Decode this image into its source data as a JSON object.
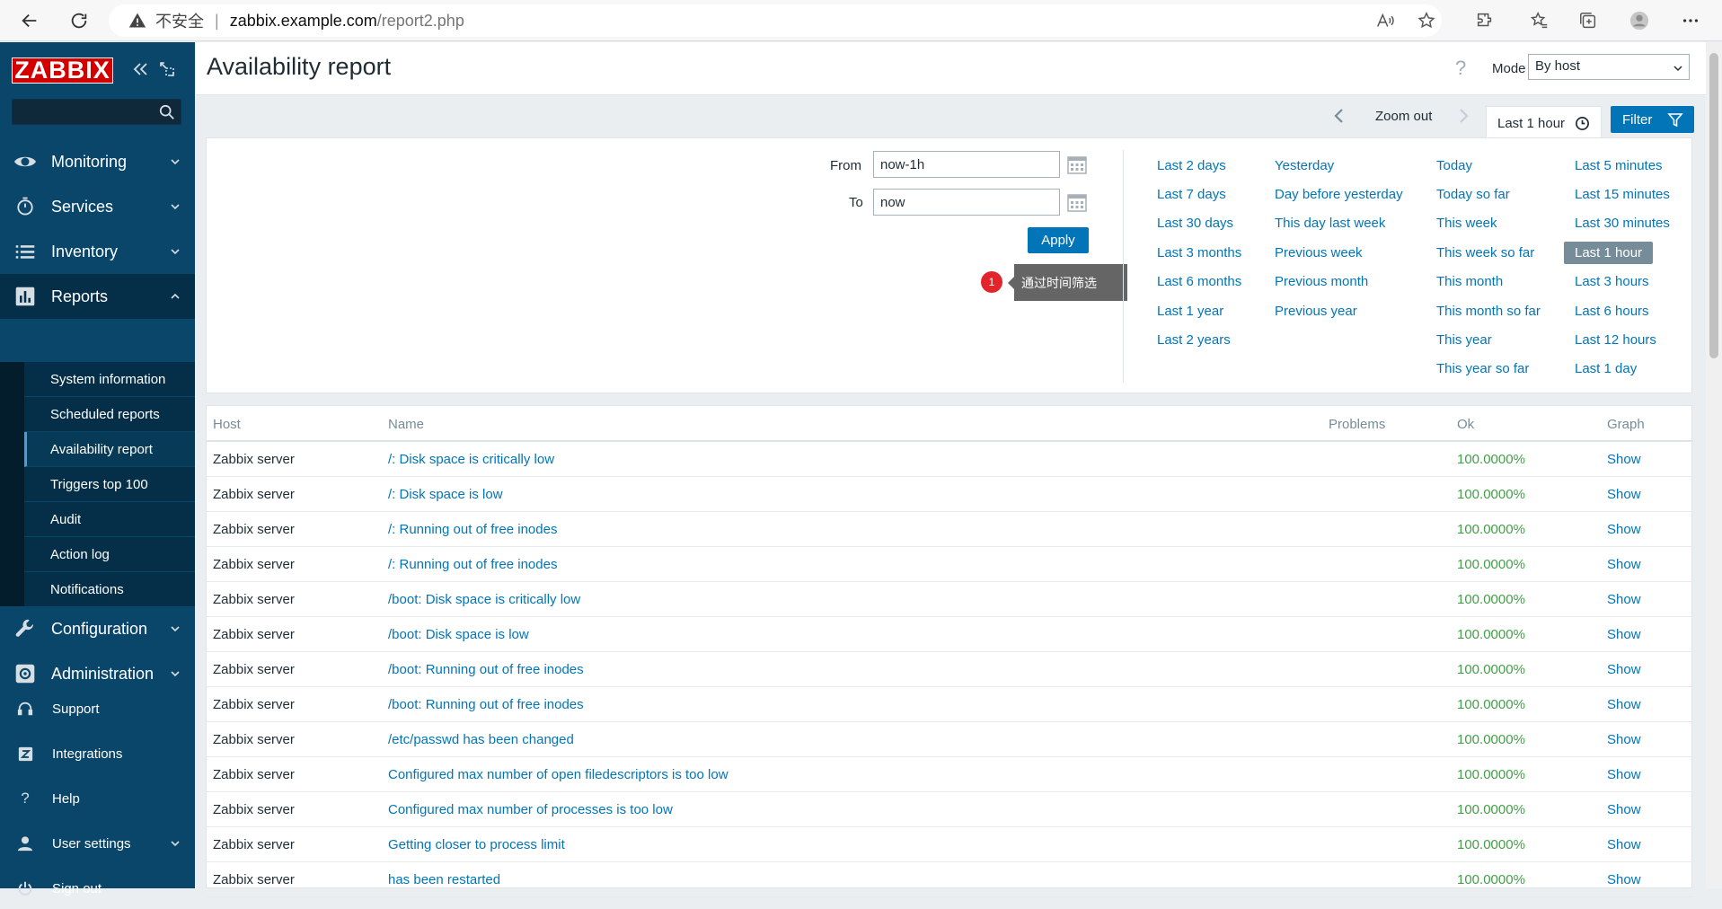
{
  "browser": {
    "insecure_label": "不安全",
    "url_host": "zabbix.example.com",
    "url_path": "/report2.php"
  },
  "sidebar": {
    "logo": "ZABBIX",
    "search_placeholder": "",
    "nav": [
      {
        "label": "Monitoring",
        "icon": "eye-icon"
      },
      {
        "label": "Services",
        "icon": "stopwatch-icon"
      },
      {
        "label": "Inventory",
        "icon": "list-icon"
      },
      {
        "label": "Reports",
        "icon": "bar-chart-icon"
      },
      {
        "label": "Configuration",
        "icon": "wrench-icon"
      },
      {
        "label": "Administration",
        "icon": "gear-icon"
      }
    ],
    "reports_sub": [
      "System information",
      "Scheduled reports",
      "Availability report",
      "Triggers top 100",
      "Audit",
      "Action log",
      "Notifications"
    ],
    "util": [
      {
        "label": "Support",
        "icon": "headset-icon"
      },
      {
        "label": "Integrations",
        "icon": "z-icon"
      },
      {
        "label": "Help",
        "icon": "question-icon"
      },
      {
        "label": "User settings",
        "icon": "user-icon"
      },
      {
        "label": "Sign out",
        "icon": "power-icon"
      }
    ]
  },
  "header": {
    "title": "Availability report",
    "help": "?",
    "mode_label": "Mode",
    "mode_value": "By host"
  },
  "filter_tabs": {
    "zoom_out": "Zoom out",
    "time_tab": "Last 1 hour",
    "filter": "Filter"
  },
  "time_filter": {
    "from_label": "From",
    "from_value": "now-1h",
    "to_label": "To",
    "to_value": "now",
    "apply": "Apply",
    "badge": "1",
    "tooltip": "通过时间筛选",
    "quick": [
      [
        "Last 2 days",
        "Last 7 days",
        "Last 30 days",
        "Last 3 months",
        "Last 6 months",
        "Last 1 year",
        "Last 2 years"
      ],
      [
        "Yesterday",
        "Day before yesterday",
        "This day last week",
        "Previous week",
        "Previous month",
        "Previous year"
      ],
      [
        "Today",
        "Today so far",
        "This week",
        "This week so far",
        "This month",
        "This month so far",
        "This year",
        "This year so far"
      ],
      [
        "Last 5 minutes",
        "Last 15 minutes",
        "Last 30 minutes",
        "Last 1 hour",
        "Last 3 hours",
        "Last 6 hours",
        "Last 12 hours",
        "Last 1 day"
      ]
    ],
    "selected": "Last 1 hour"
  },
  "table": {
    "headers": {
      "host": "Host",
      "name": "Name",
      "problems": "Problems",
      "ok": "Ok",
      "graph": "Graph"
    },
    "rows": [
      {
        "host": "Zabbix server",
        "name": "/: Disk space is critically low",
        "problems": "",
        "ok": "100.0000%",
        "graph": "Show"
      },
      {
        "host": "Zabbix server",
        "name": "/: Disk space is low",
        "problems": "",
        "ok": "100.0000%",
        "graph": "Show"
      },
      {
        "host": "Zabbix server",
        "name": "/: Running out of free inodes",
        "problems": "",
        "ok": "100.0000%",
        "graph": "Show"
      },
      {
        "host": "Zabbix server",
        "name": "/: Running out of free inodes",
        "problems": "",
        "ok": "100.0000%",
        "graph": "Show"
      },
      {
        "host": "Zabbix server",
        "name": "/boot: Disk space is critically low",
        "problems": "",
        "ok": "100.0000%",
        "graph": "Show"
      },
      {
        "host": "Zabbix server",
        "name": "/boot: Disk space is low",
        "problems": "",
        "ok": "100.0000%",
        "graph": "Show"
      },
      {
        "host": "Zabbix server",
        "name": "/boot: Running out of free inodes",
        "problems": "",
        "ok": "100.0000%",
        "graph": "Show"
      },
      {
        "host": "Zabbix server",
        "name": "/boot: Running out of free inodes",
        "problems": "",
        "ok": "100.0000%",
        "graph": "Show"
      },
      {
        "host": "Zabbix server",
        "name": "/etc/passwd has been changed",
        "problems": "",
        "ok": "100.0000%",
        "graph": "Show"
      },
      {
        "host": "Zabbix server",
        "name": "Configured max number of open filedescriptors is too low",
        "problems": "",
        "ok": "100.0000%",
        "graph": "Show"
      },
      {
        "host": "Zabbix server",
        "name": "Configured max number of processes is too low",
        "problems": "",
        "ok": "100.0000%",
        "graph": "Show"
      },
      {
        "host": "Zabbix server",
        "name": "Getting closer to process limit",
        "problems": "",
        "ok": "100.0000%",
        "graph": "Show"
      },
      {
        "host": "Zabbix server",
        "name": "has been restarted",
        "problems": "",
        "ok": "100.0000%",
        "graph": "Show"
      }
    ]
  }
}
